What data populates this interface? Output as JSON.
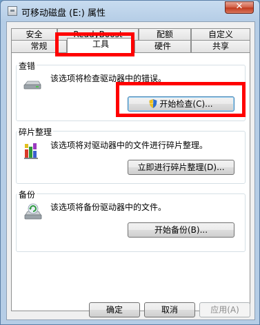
{
  "window": {
    "title": "可移动磁盘 (E:) 属性",
    "close_label": "✕"
  },
  "tabs": {
    "row1": [
      {
        "label": "安全"
      },
      {
        "label": "ReadyBoost"
      },
      {
        "label": "配额"
      },
      {
        "label": "自定义"
      }
    ],
    "row2": [
      {
        "label": "常规"
      },
      {
        "label": "工具"
      },
      {
        "label": "硬件"
      },
      {
        "label": "共享"
      }
    ]
  },
  "error_check": {
    "label": "查错",
    "description": "该选项将检查驱动器中的错误。",
    "button": "开始检查(C)..."
  },
  "defrag": {
    "label": "碎片整理",
    "description": "该选项将对驱动器中的文件进行碎片整理。",
    "button": "立即进行碎片整理(D)..."
  },
  "backup": {
    "label": "备份",
    "description": "该选项将备份驱动器中的文件。",
    "button": "开始备份(B)..."
  },
  "footer": {
    "ok": "确定",
    "cancel": "取消",
    "apply": "应用(A)"
  },
  "colors": {
    "annotation": "#ff0000",
    "title_bar": "#b5cde6"
  }
}
